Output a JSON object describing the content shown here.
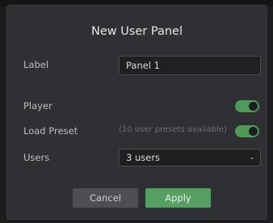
{
  "dialog": {
    "title": "New User Panel",
    "label": {
      "text": "Label",
      "value": "Panel 1"
    },
    "player": {
      "text": "Player",
      "enabled": true
    },
    "load_preset": {
      "text": "Load Preset",
      "hint": "(10 user presets available)",
      "enabled": true
    },
    "users": {
      "text": "Users",
      "value": "3 users"
    },
    "buttons": {
      "cancel": "Cancel",
      "apply": "Apply"
    }
  },
  "colors": {
    "accent": "#559f63",
    "background": "#2f3033",
    "input_bg": "#1f2022"
  },
  "icons": {
    "dropdown": "chevron-down-icon"
  }
}
